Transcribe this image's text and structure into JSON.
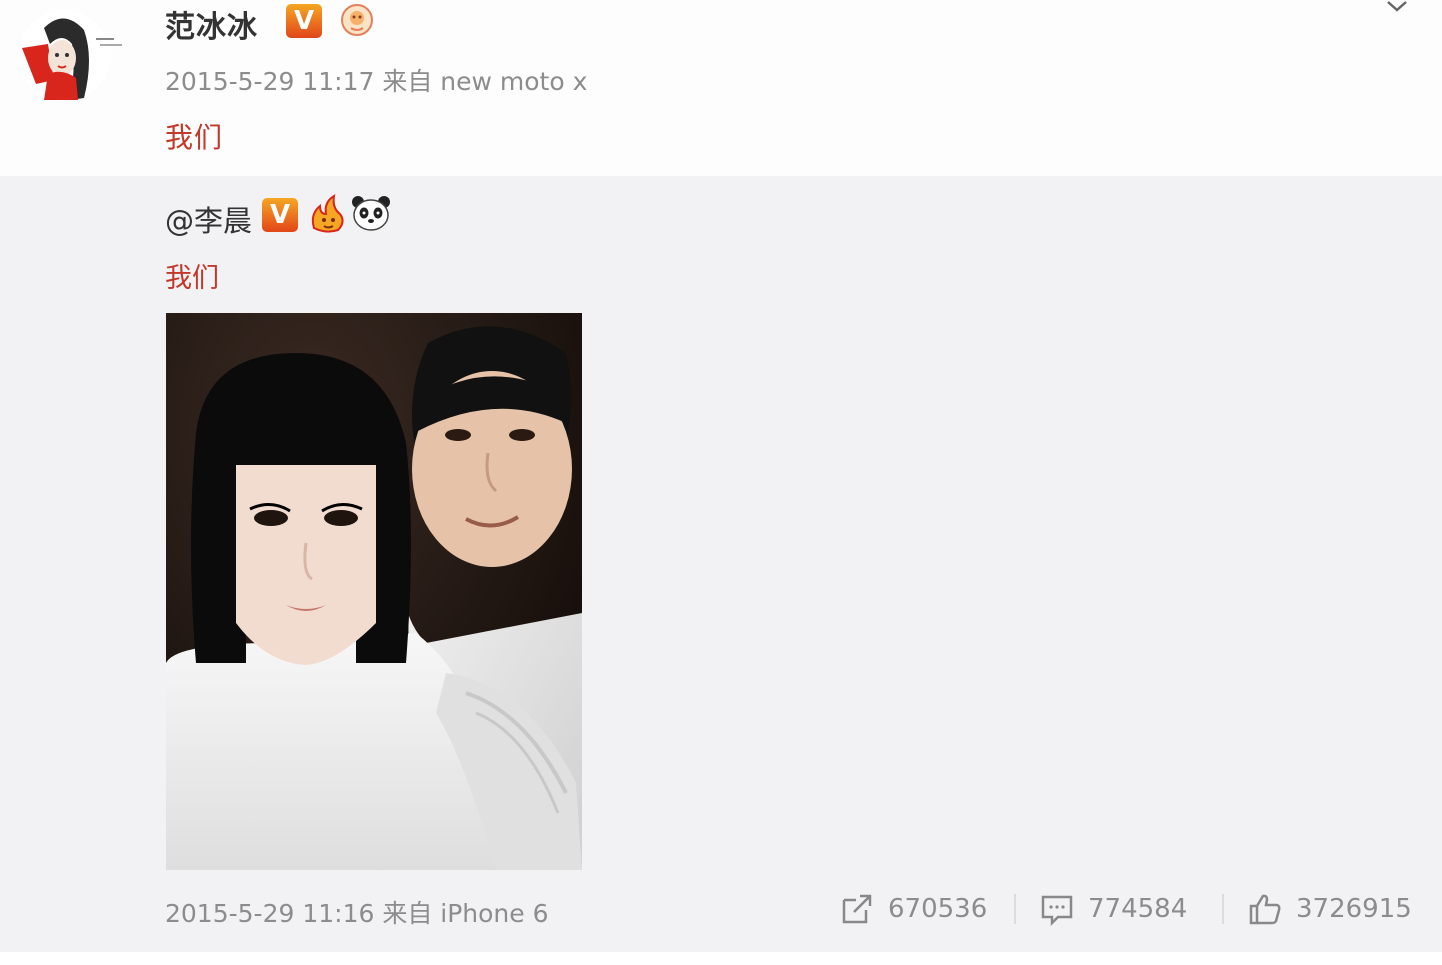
{
  "post": {
    "author": "范冰冰",
    "verified_badge": "V",
    "timestamp": "2015-5-29 11:17 来自 new moto x",
    "text": "我们"
  },
  "repost": {
    "author": "@李晨",
    "verified_badge": "V",
    "text": "我们",
    "timestamp": "2015-5-29 11:16 来自 iPhone 6",
    "actions": {
      "share_count": "670536",
      "comment_count": "774584",
      "like_count": "3726915"
    }
  },
  "icons": [
    "avatar-illustration",
    "verified-v-icon",
    "vip-badge-icon",
    "fire-emoji-icon",
    "panda-emoji-icon",
    "share-icon",
    "comment-icon",
    "like-icon",
    "chevron-down-icon"
  ],
  "colors": {
    "accent_red": "#c0392b",
    "badge_orange": "#e2461a",
    "meta_gray": "#8c8c8c",
    "repost_bg": "#f2f2f5"
  }
}
